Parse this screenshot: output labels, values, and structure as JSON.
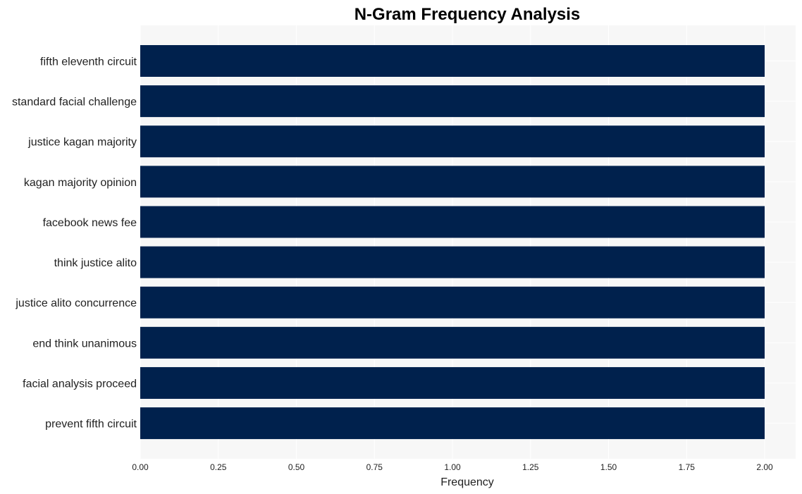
{
  "chart_data": {
    "type": "bar",
    "orientation": "horizontal",
    "title": "N-Gram Frequency Analysis",
    "xlabel": "Frequency",
    "ylabel": "",
    "categories": [
      "fifth eleventh circuit",
      "standard facial challenge",
      "justice kagan majority",
      "kagan majority opinion",
      "facebook news fee",
      "think justice alito",
      "justice alito concurrence",
      "end think unanimous",
      "facial analysis proceed",
      "prevent fifth circuit"
    ],
    "values": [
      2,
      2,
      2,
      2,
      2,
      2,
      2,
      2,
      2,
      2
    ],
    "xlim": [
      0,
      2.1
    ],
    "xticks": [
      0.0,
      0.25,
      0.5,
      0.75,
      1.0,
      1.25,
      1.5,
      1.75,
      2.0
    ],
    "xtick_labels": [
      "0.00",
      "0.25",
      "0.50",
      "0.75",
      "1.00",
      "1.25",
      "1.50",
      "1.75",
      "2.00"
    ],
    "grid": true,
    "legend": "none",
    "colors": {
      "bar": "#00214d",
      "plot_background": "#f7f7f7",
      "grid": "#ffffff"
    }
  }
}
